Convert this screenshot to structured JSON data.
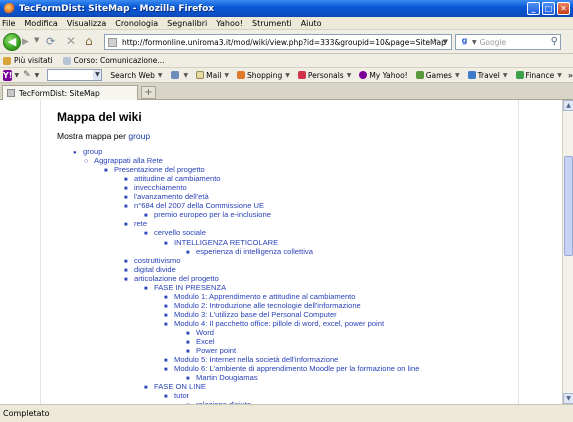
{
  "window": {
    "title": "TecFormDist: SiteMap - Mozilla Firefox"
  },
  "menu": [
    "File",
    "Modifica",
    "Visualizza",
    "Cronologia",
    "Segnalibri",
    "Yahoo!",
    "Strumenti",
    "Aiuto"
  ],
  "nav": {
    "url": "http://formonline.uniroma3.it/mod/wiki/view.php?id=333&groupid=10&page=SiteMap",
    "search_placeholder": "Google"
  },
  "bookmarks": [
    "Più visitati",
    "Corso: Comunicazione..."
  ],
  "yahoo_toolbar": {
    "items": [
      "Search Web",
      "Mail",
      "Shopping",
      "Personals",
      "My Yahoo!",
      "Games",
      "Travel",
      "Finance"
    ]
  },
  "tab": {
    "title": "TecFormDist: SiteMap"
  },
  "page": {
    "heading": "Mappa del wiki",
    "show_map_prefix": "Mostra mappa per",
    "show_map_link": "group",
    "tree": [
      {
        "label": "group",
        "level": 0
      },
      {
        "label": "Aggrappati alla Rete",
        "level": 1
      },
      {
        "label": "Presentazione del progetto",
        "level": 2
      },
      {
        "label": "attitudine al cambiamento",
        "level": 3
      },
      {
        "label": "invecchiamento",
        "level": 3
      },
      {
        "label": "l'avanzamento dell'età",
        "level": 3
      },
      {
        "label": "n°684 del 2007 della Commissione UE",
        "level": 3
      },
      {
        "label": "premio europeo per la e-inclusione",
        "level": 4
      },
      {
        "label": "rete",
        "level": 3
      },
      {
        "label": "cervello sociale",
        "level": 4
      },
      {
        "label": "INTELLIGENZA RETICOLARE",
        "level": 5
      },
      {
        "label": "esperienza di intelligenza collettiva",
        "level": 6
      },
      {
        "label": "costruttivismo",
        "level": 3
      },
      {
        "label": "digital divide",
        "level": 3
      },
      {
        "label": "articolazione del progetto",
        "level": 3
      },
      {
        "label": "FASE IN PRESENZA",
        "level": 4
      },
      {
        "label": "Modulo 1: Apprendimento e attitudine al cambiamento",
        "level": 5
      },
      {
        "label": "Modulo 2: Introduzione alle tecnologie dell'informazione",
        "level": 5
      },
      {
        "label": "Modulo 3: L'utilizzo base del Personal Computer",
        "level": 5
      },
      {
        "label": "Modulo 4: Il pacchetto office: pillole di word, excel, power point",
        "level": 5
      },
      {
        "label": "Word",
        "level": 6
      },
      {
        "label": "Excel",
        "level": 6
      },
      {
        "label": "Power point",
        "level": 6
      },
      {
        "label": "Modulo 5: Internet nella società dell'informazione",
        "level": 5
      },
      {
        "label": "Modulo 6: L'ambiente di apprendimento Moodle per la formazione on line",
        "level": 5
      },
      {
        "label": "Martin Dougiamas",
        "level": 6
      },
      {
        "label": "FASE ON LINE",
        "level": 4
      },
      {
        "label": "tutor",
        "level": 5
      },
      {
        "label": "relazione d'aiuto",
        "level": 6
      }
    ]
  },
  "status": {
    "text": "Completato"
  }
}
